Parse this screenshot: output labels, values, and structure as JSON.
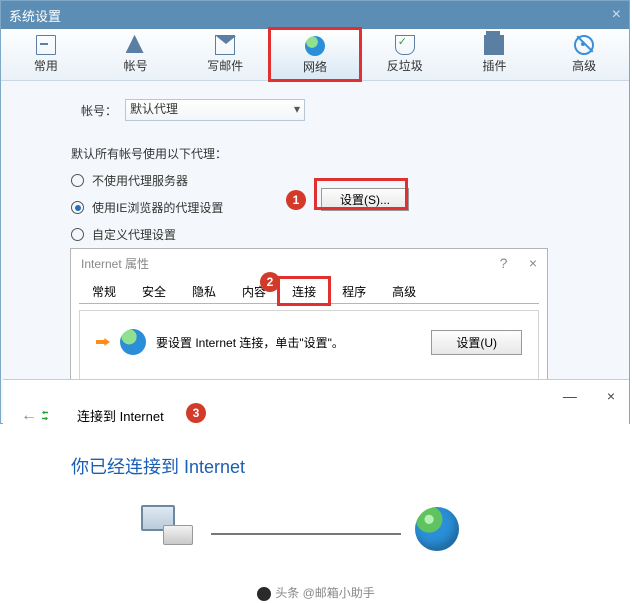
{
  "win1": {
    "title": "系统设置",
    "toolbar": [
      {
        "id": "common",
        "label": "常用"
      },
      {
        "id": "account",
        "label": "帐号"
      },
      {
        "id": "mail",
        "label": "写邮件"
      },
      {
        "id": "network",
        "label": "网络"
      },
      {
        "id": "spam",
        "label": "反垃圾"
      },
      {
        "id": "plugin",
        "label": "插件"
      },
      {
        "id": "advanced",
        "label": "高级"
      }
    ],
    "account_label": "帐号：",
    "account_value": "默认代理",
    "proxy_caption": "默认所有帐号使用以下代理：",
    "proxy_options": [
      {
        "id": "none",
        "label": "不使用代理服务器",
        "checked": false
      },
      {
        "id": "ie",
        "label": "使用IE浏览器的代理设置",
        "checked": true
      },
      {
        "id": "custom",
        "label": "自定义代理设置",
        "checked": false
      }
    ],
    "settings_btn": "设置(S)..."
  },
  "win2": {
    "title": "Internet 属性",
    "help": "?",
    "close": "×",
    "tabs": [
      "常规",
      "安全",
      "隐私",
      "内容",
      "连接",
      "程序",
      "高级"
    ],
    "active_tab": "连接",
    "body_text": "要设置 Internet 连接，单击\"设置\"。",
    "body_btn": "设置(U)"
  },
  "win3": {
    "title": "连接到 Internet",
    "min": "—",
    "close": "×",
    "message": "你已经连接到 Internet"
  },
  "bullets": {
    "b1": "1",
    "b2": "2",
    "b3": "3"
  },
  "footer": "头条 @邮箱小助手"
}
